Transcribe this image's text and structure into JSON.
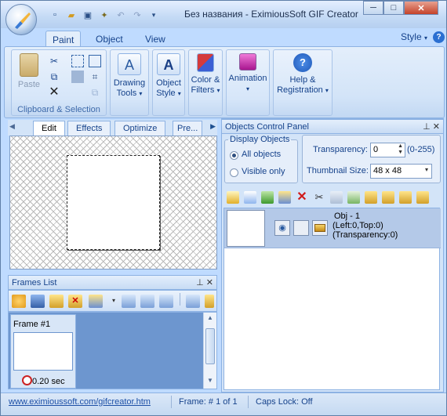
{
  "window": {
    "title": "Без названия - EximiousSoft GIF Creator"
  },
  "qat": {
    "new_icon": "new-icon",
    "open_icon": "open-folder-icon",
    "save_icon": "save-icon",
    "wizard_icon": "wizard-icon",
    "undo_icon": "undo-icon",
    "redo_icon": "redo-icon",
    "more_icon": "qat-more-icon"
  },
  "tabs": [
    {
      "label": "Paint"
    },
    {
      "label": "Object"
    },
    {
      "label": "View"
    }
  ],
  "style_label": "Style",
  "ribbon": {
    "paste_label": "Paste",
    "clipboard_group": "Clipboard & Selection",
    "drawing_tools": [
      "Drawing",
      "Tools"
    ],
    "object_style": [
      "Object",
      "Style"
    ],
    "color_filters": [
      "Color &",
      "Filters"
    ],
    "animation": "Animation",
    "help_registration": [
      "Help &",
      "Registration"
    ]
  },
  "panel_tabs": [
    {
      "label": "Edit"
    },
    {
      "label": "Effects"
    },
    {
      "label": "Optimize"
    },
    {
      "label": "Pre..."
    }
  ],
  "frames_list": {
    "header": "Frames List",
    "items": [
      {
        "label": "Frame #1",
        "delay": "0.20 sec"
      }
    ]
  },
  "ocp": {
    "header": "Objects Control Panel",
    "display_objects_legend": "Display Objects",
    "all_objects": "All objects",
    "visible_only": "Visible only",
    "transparency_label": "Transparency:",
    "transparency_value": "0",
    "transparency_range": "(0-255)",
    "thumbnail_label": "Thumbnail Size:",
    "thumbnail_value": "48 x 48",
    "objects": [
      {
        "name": "Obj - 1",
        "position": "(Left:0,Top:0)",
        "transparency": "(Transparency:0)"
      }
    ]
  },
  "status": {
    "link": "www.eximioussoft.com/gifcreator.htm",
    "frame": "Frame: # 1 of 1",
    "caps": "Caps Lock: Off"
  },
  "colors": {
    "accent": "#15428b",
    "ribbon": "#d3e4f8",
    "selection": "#b4c9e8"
  }
}
